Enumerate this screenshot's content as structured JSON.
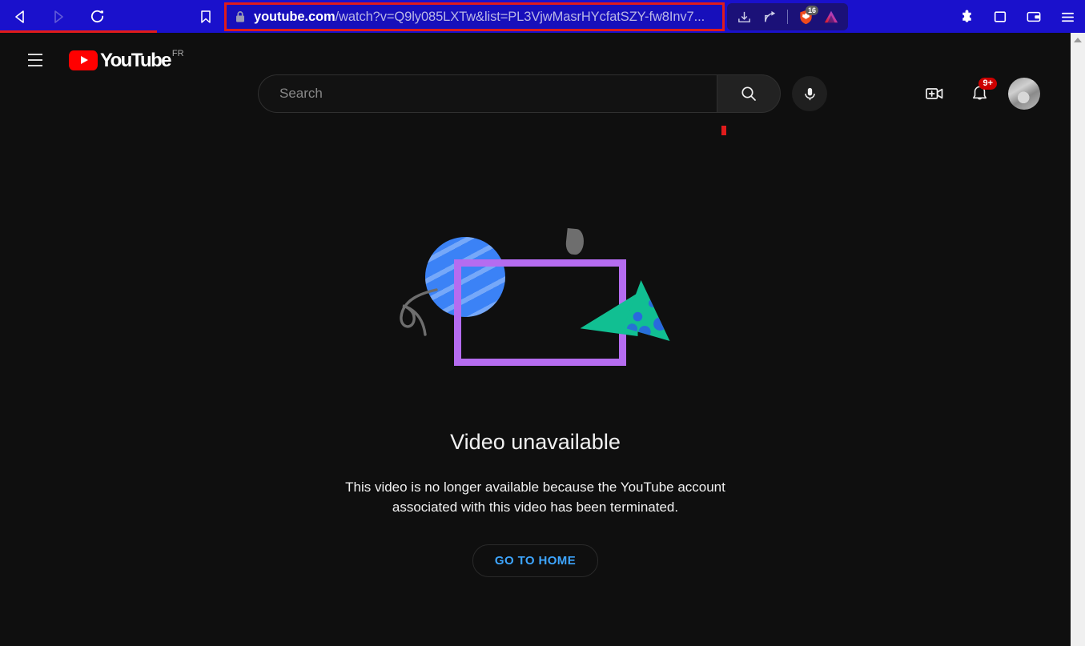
{
  "browser": {
    "nav": {
      "back_label": "Back",
      "forward_label": "Forward",
      "reload_label": "Reload",
      "bookmark_label": "Bookmark"
    },
    "url": {
      "host": "youtube.com",
      "path": "/watch?v=Q9ly085LXTw&list=PL3VjwMasrHYcfatSZY-fw8Inv7...",
      "full": "youtube.com/watch?v=Q9ly085LXTw&list=PL3VjwMasrHYcfatSZY-fw8Inv7...",
      "security_icon": "lock-icon"
    },
    "actions": [
      {
        "name": "download-icon",
        "label": "Downloads"
      },
      {
        "name": "share-icon",
        "label": "Share"
      },
      {
        "name": "brave-shields-icon",
        "label": "Brave Shields",
        "badge": "16"
      },
      {
        "name": "leo-ai-icon",
        "label": "Leo AI"
      }
    ],
    "right_actions": [
      {
        "name": "extensions-puzzle-icon",
        "label": "Extensions"
      },
      {
        "name": "sidebar-icon",
        "label": "Sidebar"
      },
      {
        "name": "wallet-icon",
        "label": "Brave Wallet"
      },
      {
        "name": "main-menu-icon",
        "label": "Customize and control Brave"
      }
    ],
    "annotation_color": "#e01b1b",
    "toolbar_color": "#1a11cc"
  },
  "youtube": {
    "hamburger_label": "Guide",
    "logo_text": "YouTube",
    "country_code": "FR",
    "search": {
      "placeholder": "Search",
      "value": "",
      "button_label": "Search",
      "mic_label": "Search with your voice"
    },
    "header_right": {
      "create_label": "Create",
      "notifications_label": "Notifications",
      "notifications_badge": "9+",
      "avatar_label": "Account menu"
    },
    "error": {
      "title": "Video unavailable",
      "description": "This video is no longer available because the YouTube account associated with this video has been terminated.",
      "button_label": "GO TO HOME"
    },
    "colors": {
      "background": "#0f0f0f",
      "link_blue": "#3ea6ff",
      "brand_red": "#ff0000",
      "art_purple": "#b56cf0",
      "art_blue": "#3b82f6",
      "art_teal": "#11bf92",
      "art_gray": "#6e6e6e"
    }
  },
  "scrollbar": {
    "up_arrow_label": "Scroll up"
  }
}
